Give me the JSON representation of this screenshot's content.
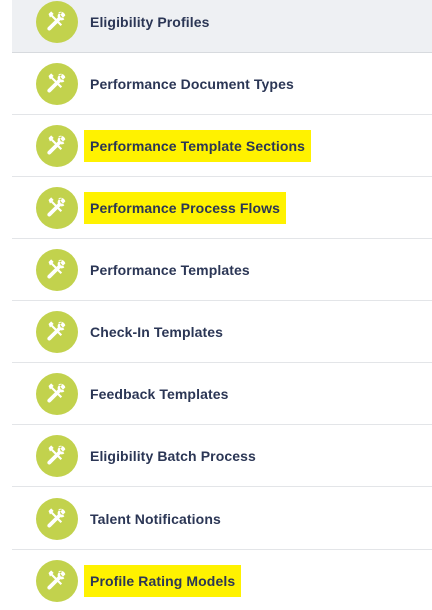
{
  "items": [
    {
      "label": "Eligibility Profiles",
      "icon": "tools-icon",
      "selected": true,
      "highlighted": false
    },
    {
      "label": "Performance Document Types",
      "icon": "tools-icon",
      "selected": false,
      "highlighted": false
    },
    {
      "label": "Performance Template Sections",
      "icon": "tools-icon",
      "selected": false,
      "highlighted": true
    },
    {
      "label": "Performance Process Flows",
      "icon": "tools-icon",
      "selected": false,
      "highlighted": true
    },
    {
      "label": "Performance Templates",
      "icon": "tools-icon",
      "selected": false,
      "highlighted": false
    },
    {
      "label": "Check-In Templates",
      "icon": "tools-icon",
      "selected": false,
      "highlighted": false
    },
    {
      "label": "Feedback Templates",
      "icon": "tools-icon",
      "selected": false,
      "highlighted": false
    },
    {
      "label": "Eligibility Batch Process",
      "icon": "tools-icon",
      "selected": false,
      "highlighted": false
    },
    {
      "label": "Talent Notifications",
      "icon": "tools-icon",
      "selected": false,
      "highlighted": false
    },
    {
      "label": "Profile Rating Models",
      "icon": "tools-icon",
      "selected": false,
      "highlighted": true
    }
  ],
  "colors": {
    "icon_bg": "#c2d24d",
    "label_text": "#2b3655",
    "highlight": "#fff200",
    "selected_row_bg": "#eef0f3"
  }
}
